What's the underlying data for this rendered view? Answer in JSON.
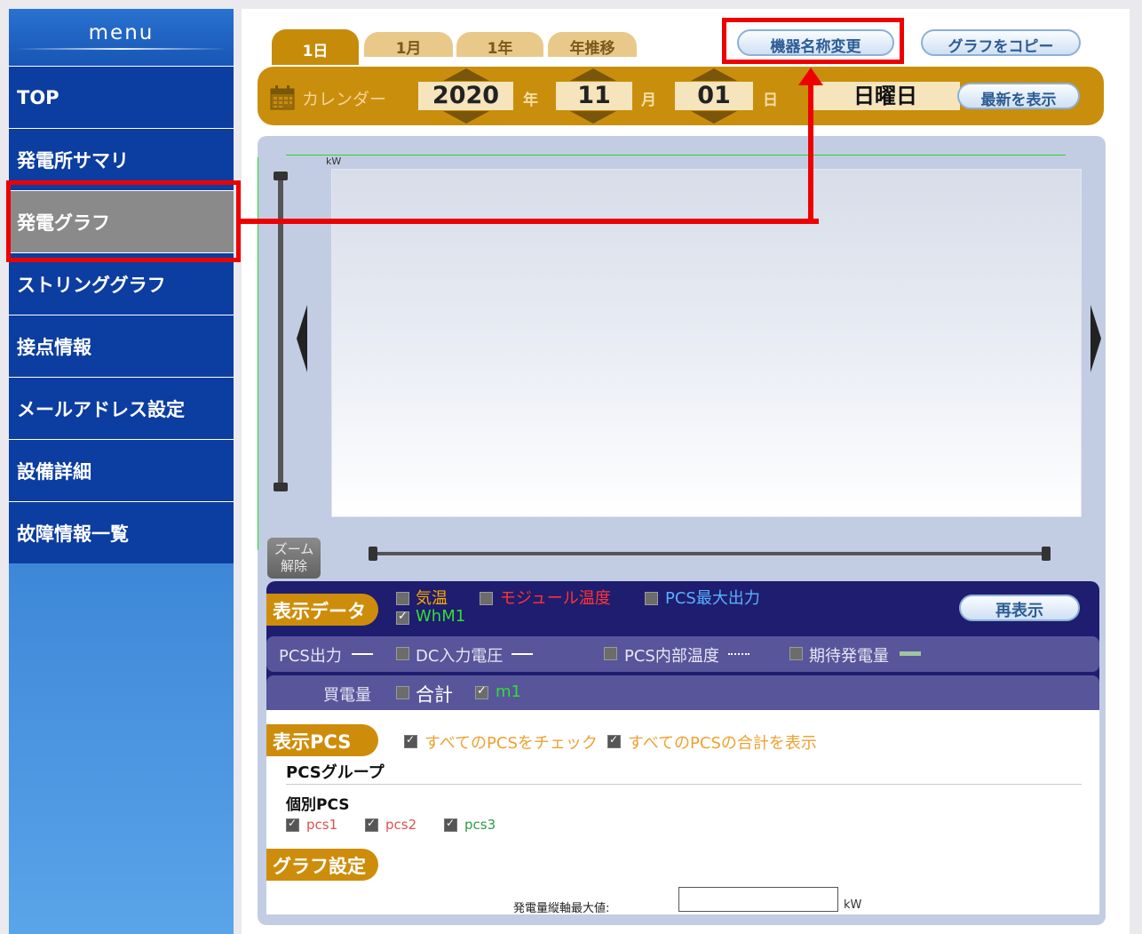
{
  "sidebar": {
    "header": "menu",
    "items": [
      {
        "label": "TOP"
      },
      {
        "label": "発電所サマリ"
      },
      {
        "label": "発電グラフ"
      },
      {
        "label": "ストリンググラフ"
      },
      {
        "label": "接点情報"
      },
      {
        "label": "メールアドレス設定"
      },
      {
        "label": "設備詳細"
      },
      {
        "label": "故障情報一覧"
      }
    ],
    "active_item": "発電グラフ"
  },
  "tabs": [
    {
      "label": "1日",
      "active": true
    },
    {
      "label": "1月"
    },
    {
      "label": "1年"
    },
    {
      "label": "年推移"
    }
  ],
  "toolbar": {
    "rename_device_label": "機器名称変更",
    "copy_graph_label": "グラフをコピー"
  },
  "date": {
    "calendar_label": "カレンダー",
    "year": "2020",
    "year_unit": "年",
    "month": "11",
    "month_unit": "月",
    "day": "01",
    "day_unit": "日",
    "weekday": "日曜日",
    "latest_label": "最新を表示"
  },
  "graph": {
    "y_unit": "kW",
    "zoom_reset_line1": "ズーム",
    "zoom_reset_line2": "解除"
  },
  "display_data": {
    "title": "表示データ",
    "redisplay_label": "再表示",
    "options_row1": [
      {
        "label": "気温",
        "checked": false,
        "color": "#f6a800"
      },
      {
        "label": "モジュール温度",
        "checked": false,
        "color": "#ff3333"
      },
      {
        "label": "PCS最大出力",
        "checked": false,
        "color": "#5ab0ff"
      },
      {
        "label": "WhM1",
        "checked": true,
        "color": "#33dd33"
      }
    ],
    "options_row2": {
      "pcs_output_label": "PCS出力",
      "dc_voltage_label": "DC入力電圧",
      "pcs_temp_label": "PCS内部温度",
      "expected_label": "期待発電量"
    },
    "options_row3": {
      "buy_label": "買電量",
      "total_label": "合計",
      "m1_label": "m1"
    }
  },
  "display_pcs": {
    "title": "表示PCS",
    "check_all_label": "すべてのPCSをチェック",
    "show_total_label": "すべてのPCSの合計を表示",
    "group_label": "PCSグループ",
    "individual_label": "個別PCS",
    "pcs": [
      {
        "label": "pcs1",
        "color": "#e05050"
      },
      {
        "label": "pcs2",
        "color": "#e05050"
      },
      {
        "label": "pcs3",
        "color": "#2e9a48"
      }
    ]
  },
  "graph_settings": {
    "title": "グラフ設定",
    "max_label": "発電量縦軸最大値:",
    "max_value": "",
    "unit": "kW"
  },
  "colors": {
    "annotation": "#ee0000",
    "sidebar_bg": "#0c3da0",
    "accent": "#c98e0c"
  }
}
